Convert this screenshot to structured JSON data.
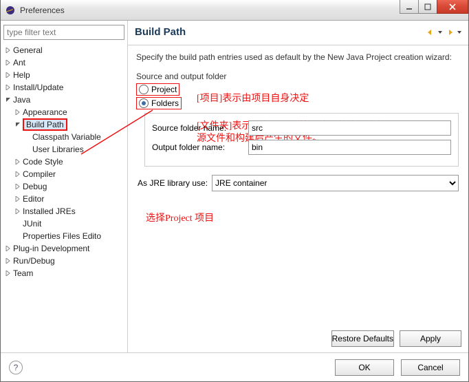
{
  "window": {
    "title": "Preferences"
  },
  "filter_placeholder": "type filter text",
  "tree": [
    {
      "label": "General",
      "expand": "closed"
    },
    {
      "label": "Ant",
      "expand": "closed"
    },
    {
      "label": "Help",
      "expand": "closed"
    },
    {
      "label": "Install/Update",
      "expand": "closed"
    },
    {
      "label": "Java",
      "expand": "open",
      "children": [
        {
          "label": "Appearance",
          "expand": "closed"
        },
        {
          "label": "Build Path",
          "expand": "open",
          "highlight": true,
          "children": [
            {
              "label": "Classpath Variable",
              "expand": "none"
            },
            {
              "label": "User Libraries",
              "expand": "none"
            }
          ]
        },
        {
          "label": "Code Style",
          "expand": "closed"
        },
        {
          "label": "Compiler",
          "expand": "closed"
        },
        {
          "label": "Debug",
          "expand": "closed"
        },
        {
          "label": "Editor",
          "expand": "closed"
        },
        {
          "label": "Installed JREs",
          "expand": "closed"
        },
        {
          "label": "JUnit",
          "expand": "none"
        },
        {
          "label": "Properties Files Edito",
          "expand": "none"
        }
      ]
    },
    {
      "label": "Plug-in Development",
      "expand": "closed"
    },
    {
      "label": "Run/Debug",
      "expand": "closed"
    },
    {
      "label": "Team",
      "expand": "closed"
    }
  ],
  "page": {
    "heading": "Build Path",
    "description": "Specify the build path entries used as default by the New Java Project creation wizard:",
    "source_label": "Source and output folder",
    "radio_project": "Project",
    "radio_folders": "Folders",
    "source_folder_label": "Source folder name:",
    "source_folder_value": "src",
    "output_folder_label": "Output folder name:",
    "output_folder_value": "bin",
    "jre_label": "As JRE library use:",
    "jre_value": "JRE container"
  },
  "annotations": {
    "proj": "[项目]表示由项目自身决定",
    "folders1": "[文件夹]表示所有项目都按照这里的文件夹放置",
    "folders2": "源文件和构建后产生的文件。",
    "select": "选择Project 项目"
  },
  "buttons": {
    "restore": "Restore Defaults",
    "apply": "Apply",
    "ok": "OK",
    "cancel": "Cancel"
  }
}
